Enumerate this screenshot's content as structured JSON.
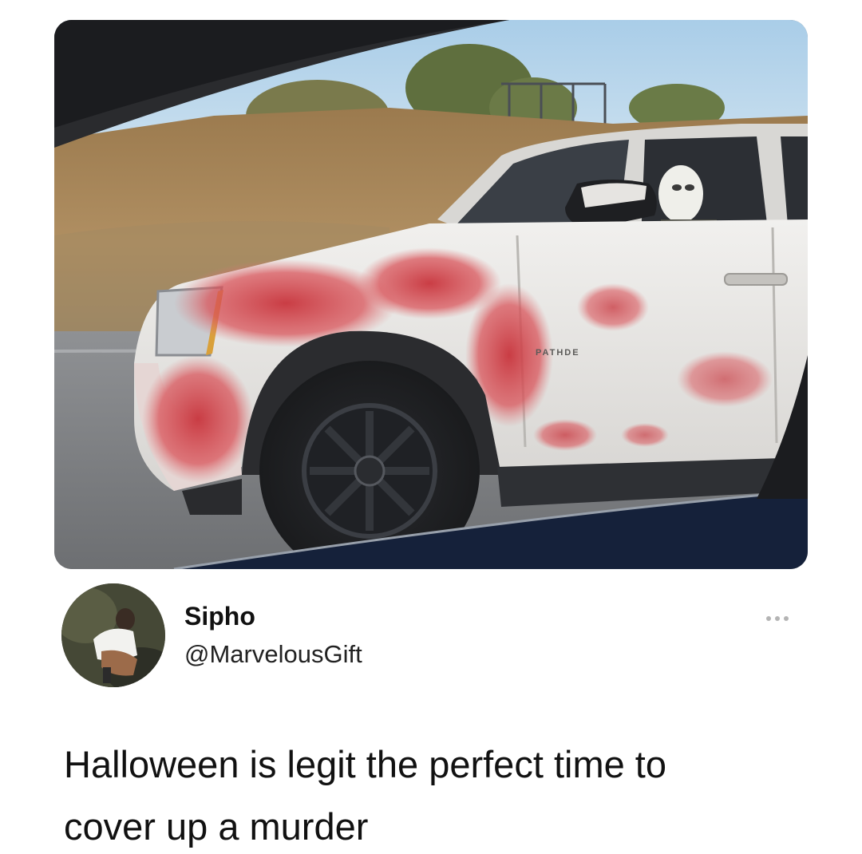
{
  "photo": {
    "description_icon": "photo-image",
    "door_badge_text": "PATHDE"
  },
  "tweet": {
    "author": {
      "display_name": "Sipho",
      "handle": "@MarvelousGift",
      "avatar_icon": "avatar-photo"
    },
    "more_icon": "ellipsis-icon",
    "text": "Halloween is legit the perfect time to\ncover up a murder"
  },
  "colors": {
    "background": "#ffffff",
    "text": "#111111",
    "handle_text": "#222222",
    "more_dots": "#b4b4b4"
  }
}
